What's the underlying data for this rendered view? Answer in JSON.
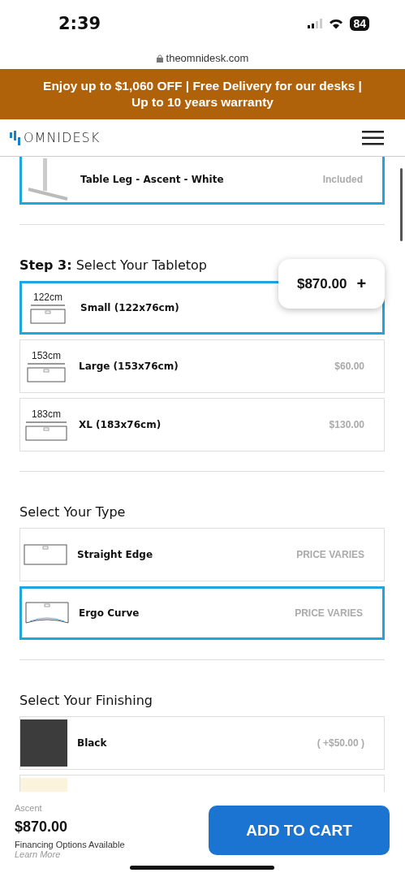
{
  "status_bar": {
    "time": "2:39",
    "battery": "84"
  },
  "url_bar": {
    "url": "theomnidesk.com"
  },
  "promo_banner": {
    "lines": [
      "Enjoy up to $1,060 OFF | Free Delivery for our desks |",
      "Up to 10 years warranty"
    ]
  },
  "header": {
    "logo": "OMNIDESK"
  },
  "leg_option": {
    "label": "Table Leg - Ascent - White",
    "price": "Included",
    "selected": true
  },
  "tabletop": {
    "step": "Step 3:",
    "title": "Select Your Tabletop",
    "options": [
      {
        "size": "122cm",
        "label": "Small (122x76cm)",
        "selected": true
      },
      {
        "size": "153cm",
        "label": "Large (153x76cm)",
        "price": "$60.00",
        "selected": false
      },
      {
        "size": "183cm",
        "label": "XL (183x76cm)",
        "price": "$130.00",
        "selected": false
      }
    ]
  },
  "type_section": {
    "title": "Select Your Type",
    "options": [
      {
        "kind": "straight",
        "label": "Straight Edge",
        "price": "PRICE VARIES",
        "selected": false
      },
      {
        "kind": "curve",
        "label": "Ergo Curve",
        "price": "PRICE VARIES",
        "selected": true
      }
    ]
  },
  "finishing": {
    "title": "Select Your Finishing",
    "options": [
      {
        "label": "Black",
        "price": "( +$50.00 )",
        "color": "#3c3c3c",
        "selected": false
      },
      {
        "color": "#fbf3dc",
        "selected": false
      }
    ]
  },
  "price_badge": {
    "price": "$870.00",
    "icon": "+"
  },
  "cart_bar": {
    "product": "Ascent",
    "price": "$870.00",
    "financing": "Financing Options Available",
    "link": "Learn More",
    "button": "ADD TO CART"
  }
}
